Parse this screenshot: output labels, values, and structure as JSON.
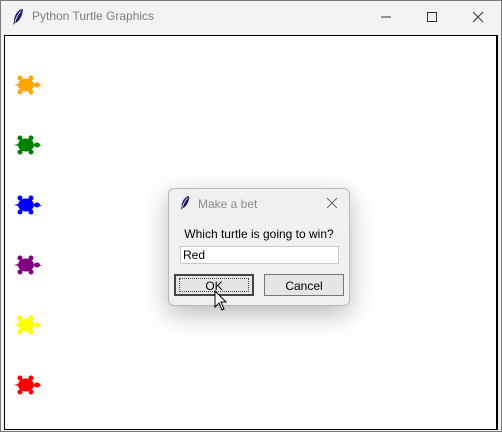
{
  "window": {
    "title": "Python Turtle Graphics",
    "controls": {
      "minimize": "minimize-icon",
      "maximize": "maximize-icon",
      "close": "close-icon"
    }
  },
  "turtles": [
    {
      "name": "orange-turtle",
      "color": "#ffa500"
    },
    {
      "name": "green-turtle",
      "color": "#008000"
    },
    {
      "name": "blue-turtle",
      "color": "#0000ff"
    },
    {
      "name": "purple-turtle",
      "color": "#800080"
    },
    {
      "name": "yellow-turtle",
      "color": "#ffff00"
    },
    {
      "name": "red-turtle",
      "color": "#ff0000"
    }
  ],
  "dialog": {
    "title": "Make a bet",
    "prompt": "Which turtle is going to win?",
    "input_value": "Red",
    "ok_label": "OK",
    "cancel_label": "Cancel"
  }
}
